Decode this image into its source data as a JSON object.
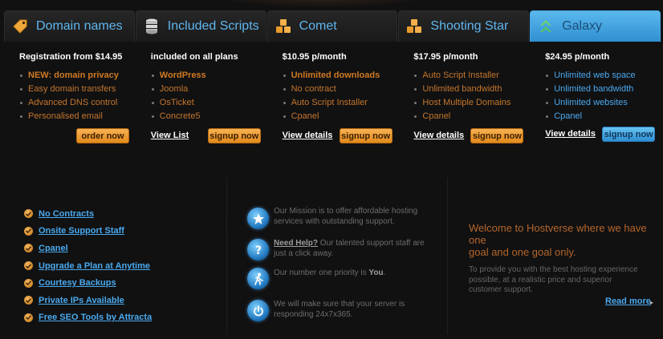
{
  "tabs": [
    {
      "label": "Domain names",
      "icon": "tag-icon"
    },
    {
      "label": "Included Scripts",
      "icon": "database-icon"
    },
    {
      "label": "Comet",
      "icon": "cubes-icon"
    },
    {
      "label": "Shooting Star",
      "icon": "cubes-icon"
    },
    {
      "label": "Galaxy",
      "icon": "chevrons-up-icon",
      "active": true
    }
  ],
  "plans": [
    {
      "title": "Registration from $14.95",
      "features": [
        "NEW: domain privacy",
        "Easy domain transfers",
        "Advanced DNS control",
        "Personalised email"
      ],
      "button": "order now"
    },
    {
      "title": "included on all plans",
      "features": [
        "WordPress",
        "Joomla",
        "OsTicket",
        "Concrete5"
      ],
      "link": "View List",
      "button": "signup now"
    },
    {
      "title": "$10.95 p/month",
      "features": [
        "Unlimited downloads",
        "No contract",
        "Auto Script Installer",
        "Cpanel"
      ],
      "link": "View details",
      "button": "signup now"
    },
    {
      "title": "$17.95 p/month",
      "features": [
        "Auto Script Installer",
        "Unlimited bandwidth",
        "Host Multiple Domains",
        "Cpanel"
      ],
      "link": "View details",
      "button": "signup now"
    },
    {
      "title": "$24.95 p/month",
      "features": [
        "Unlimited web space",
        "Unlimited bandwidth",
        "Unlimited websites",
        "Cpanel"
      ],
      "link": "View details",
      "button": "signup now"
    }
  ],
  "benefits": [
    "No Contracts",
    "Onsite Support Staff",
    "Cpanel",
    "Upgrade a Plan at Anytime",
    "Courtesy Backups",
    "Private IPs Available",
    "Free SEO Tools by Attracta"
  ],
  "mission": {
    "row1": {
      "line1": "Our Mission is to offer affordable hosting",
      "line2": "services with outstanding support."
    },
    "row2": {
      "link": "Need Help?",
      "line1": " Our talented support staff are",
      "line2": "just a click away."
    },
    "row3": {
      "prefix": "Our number one priority is ",
      "bold": "You",
      "suffix": "."
    },
    "row4": {
      "line1": "We will make sure that your server is",
      "line2": "responding 24x7x365."
    }
  },
  "welcome": {
    "title_line1": "Welcome to Hostverse where we have one",
    "title_line2": "goal and one goal only.",
    "text_line1": "To provide you with the best hosting experience",
    "text_line2": "possible, at a realistic price and superior",
    "text_line3": "customer support.",
    "read_more": "Read more",
    "arrow": "▸"
  },
  "colors": {
    "accent_blue": "#4aa9ee",
    "accent_orange": "#e18a1c",
    "background": "#111112"
  }
}
